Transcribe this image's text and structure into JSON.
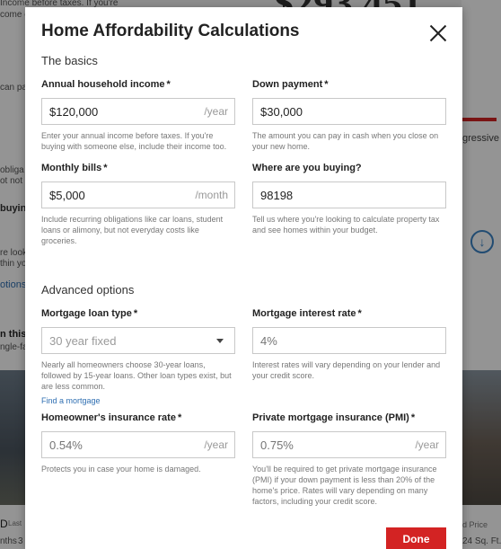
{
  "background": {
    "left_texts": [
      "Income before taxes. If you're",
      "come els",
      "can pay",
      "obliga",
      "ot not",
      "buyin",
      "re looki",
      "thin yo",
      "otions",
      "n this",
      "ngle-fa",
      "D",
      "Last",
      "nths",
      "3"
    ],
    "right_texts": [
      "gressive",
      "d Price",
      "24 Sq. Ft."
    ],
    "price_fragment": "$293,451"
  },
  "modal": {
    "title": "Home Affordability Calculations",
    "basics_heading": "The basics",
    "advanced_heading": "Advanced options",
    "done_label": "Done",
    "accent_color": "#d32323",
    "link_color": "#2f6fb2"
  },
  "fields": {
    "annual_income": {
      "label": "Annual household income",
      "required": "*",
      "value": "$120,000",
      "suffix": "/year",
      "help": "Enter your annual income before taxes. If you're buying with someone else, include their income too."
    },
    "down_payment": {
      "label": "Down payment",
      "required": "*",
      "value": "$30,000",
      "help": "The amount you can pay in cash when you close on your new home."
    },
    "monthly_bills": {
      "label": "Monthly bills",
      "required": "*",
      "value": "$5,000",
      "suffix": "/month",
      "help": "Include recurring obligations like car loans, student loans or alimony, but not everyday costs like groceries."
    },
    "location": {
      "label": "Where are you buying?",
      "value": "98198",
      "help": "Tell us where you're looking to calculate property tax and see homes within your budget."
    },
    "loan_type": {
      "label": "Mortgage loan type",
      "required": "*",
      "value": "30 year fixed",
      "help": "Nearly all homeowners choose 30-year loans, followed by 15-year loans. Other loan types exist, but are less common.",
      "link": "Find a mortgage"
    },
    "interest_rate": {
      "label": "Mortgage interest rate",
      "required": "*",
      "placeholder": "4%",
      "help": "Interest rates will vary depending on your lender and your credit score."
    },
    "insurance_rate": {
      "label": "Homeowner's insurance rate",
      "required": "*",
      "placeholder": "0.54%",
      "suffix": "/year",
      "help": "Protects you in case your home is damaged."
    },
    "pmi": {
      "label": "Private mortgage insurance (PMI)",
      "required": "*",
      "placeholder": "0.75%",
      "suffix": "/year",
      "help": "You'll be required to get private mortgage insurance (PMI) if your down payment is less than 20% of the home's price. Rates will vary depending on many factors, including your credit score."
    }
  }
}
